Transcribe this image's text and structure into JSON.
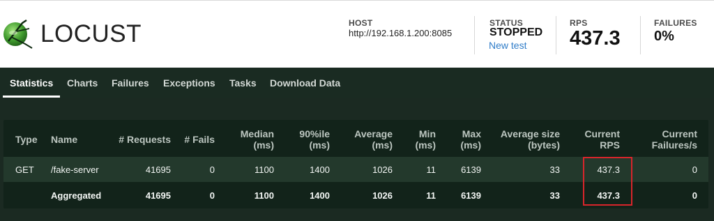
{
  "header": {
    "app_name": "LOCUST",
    "host_label": "HOST",
    "host_value": "http://192.168.1.200:8085",
    "status_label": "STATUS",
    "status_value": "STOPPED",
    "new_test_link": "New test",
    "rps_label": "RPS",
    "rps_value": "437.3",
    "failures_label": "FAILURES",
    "failures_value": "0%"
  },
  "tabs": [
    {
      "label": "Statistics",
      "active": true
    },
    {
      "label": "Charts"
    },
    {
      "label": "Failures"
    },
    {
      "label": "Exceptions"
    },
    {
      "label": "Tasks"
    },
    {
      "label": "Download Data"
    }
  ],
  "table": {
    "headers": [
      [
        "Type"
      ],
      [
        "Name"
      ],
      [
        "# Requests"
      ],
      [
        "# Fails"
      ],
      [
        "Median",
        "(ms)"
      ],
      [
        "90%ile",
        "(ms)"
      ],
      [
        "Average",
        "(ms)"
      ],
      [
        "Min",
        "(ms)"
      ],
      [
        "Max",
        "(ms)"
      ],
      [
        "Average size",
        "(bytes)"
      ],
      [
        "Current",
        "RPS"
      ],
      [
        "Current",
        "Failures/s"
      ]
    ],
    "rows": [
      {
        "type": "GET",
        "name": "/fake-server",
        "requests": "41695",
        "fails": "0",
        "median": "1100",
        "p90": "1400",
        "average": "1026",
        "min": "11",
        "max": "6139",
        "avg_size": "33",
        "current_rps": "437.3",
        "current_failures": "0"
      },
      {
        "type": "",
        "name": "Aggregated",
        "requests": "41695",
        "fails": "0",
        "median": "1100",
        "p90": "1400",
        "average": "1026",
        "min": "11",
        "max": "6139",
        "avg_size": "33",
        "current_rps": "437.3",
        "current_failures": "0"
      }
    ]
  },
  "colors": {
    "background": "#1b2a22",
    "header_bg": "#ffffff",
    "link": "#2f7cc8",
    "highlight_box": "#d9252b"
  },
  "icons": [
    "locust-logo-icon"
  ]
}
